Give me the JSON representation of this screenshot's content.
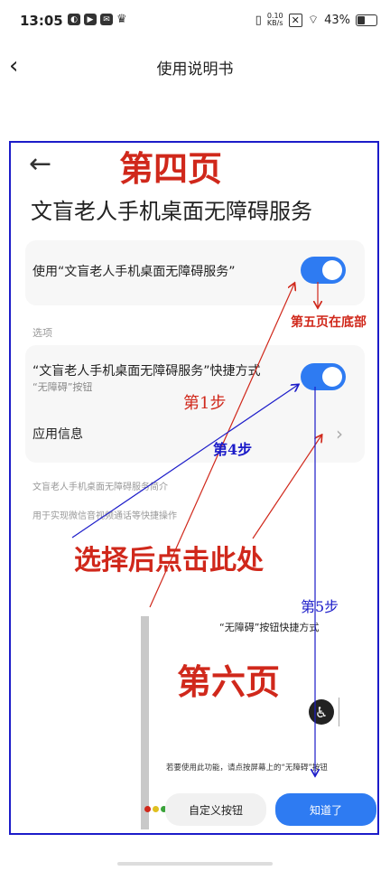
{
  "status": {
    "time": "13:05",
    "speed_top": "0.10",
    "speed_bottom": "KB/s",
    "battery": "43%"
  },
  "nav": {
    "title": "使用说明书"
  },
  "screen": {
    "page_label": "第四页",
    "title": "文盲老人手机桌面无障碍服务",
    "use_label": "使用“文盲老人手机桌面无障碍服务”",
    "options_header": "选项",
    "shortcut_label": "“文盲老人手机桌面无障碍服务”快捷方式",
    "shortcut_sub": "“无障碍”按钮",
    "app_info": "应用信息",
    "intro_title": "文盲老人手机桌面无障碍服务简介",
    "intro_body": "用于实现微信音视频通话等快捷操作"
  },
  "annotations": {
    "step1": "第1步",
    "step4": "第4步",
    "step5": "第5步",
    "page5_bottom": "第五页在底部",
    "select_click": "选择后点击此处",
    "page6": "第六页"
  },
  "sheet": {
    "title": "“无障碍”按钮快捷方式",
    "hint": "若要使用此功能，请点按屏幕上的“无障碍”按钮",
    "custom_button": "自定义按钮",
    "ok_button": "知道了"
  },
  "colors": {
    "accent": "#2e7bf2",
    "annotation_red": "#d0281b",
    "annotation_blue": "#1c1cc9"
  }
}
